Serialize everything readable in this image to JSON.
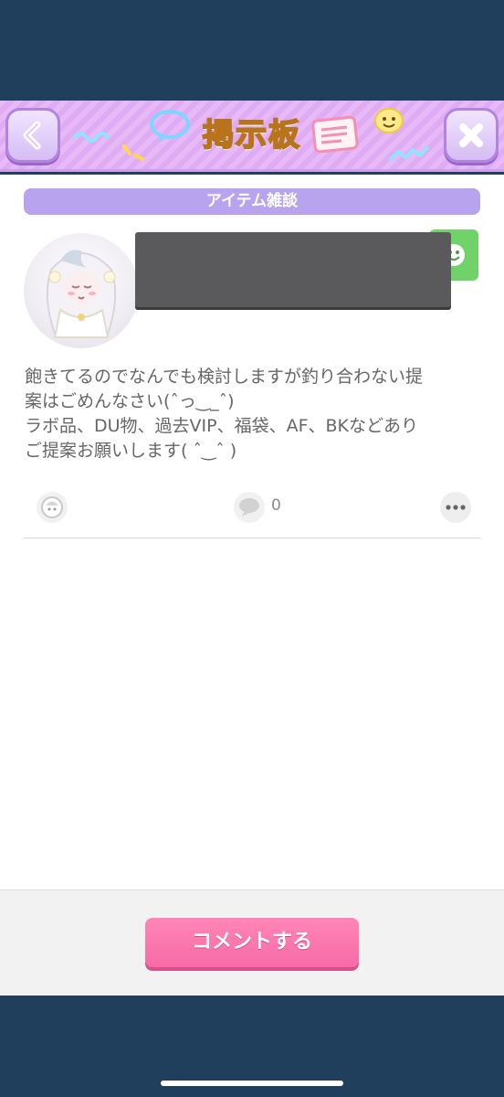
{
  "header": {
    "title": "掲示板",
    "back_icon": "chevron-left-icon",
    "close_icon": "close-icon",
    "colors": {
      "band": "#e7b9f6",
      "title": "#f5b840"
    }
  },
  "post": {
    "category": "アイテム雑談",
    "body_lines": [
      "飽きてるのでなんでも検討しますが釣り合わない提",
      "案はごめんなさい(ˆっ‿_ˆ)",
      "ラボ品、DU物、過去VIP、福袋、AF、BKなどあり",
      "ご提案お願いします( ˆ‿ˆ )"
    ],
    "comment_count": "0"
  },
  "footer": {
    "comment_button_label": "コメントする",
    "colors": {
      "button": "#f86aa6"
    }
  }
}
